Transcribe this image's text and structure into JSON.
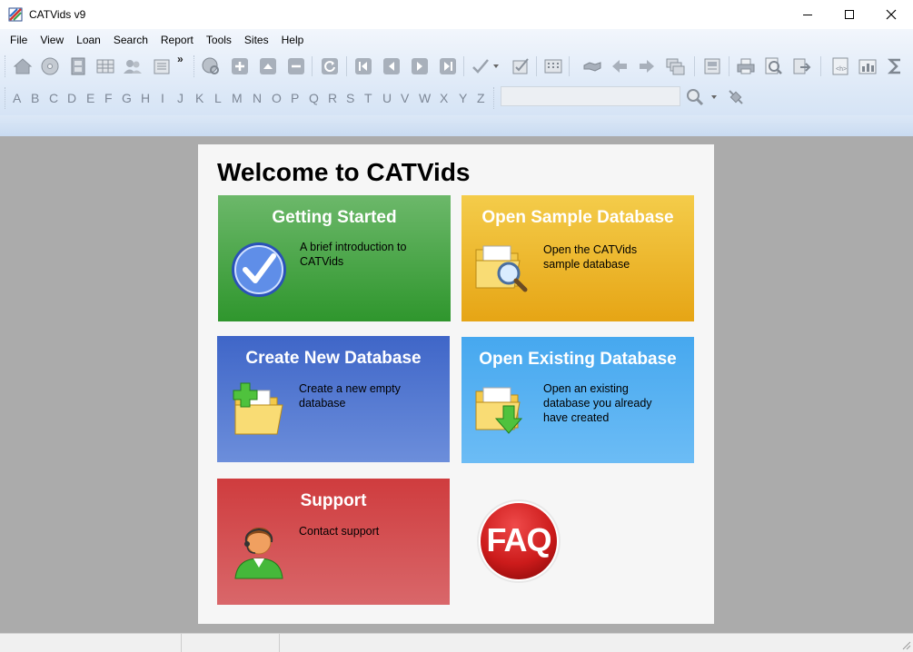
{
  "window": {
    "title": "CATVids v9"
  },
  "menu": [
    "File",
    "View",
    "Loan",
    "Search",
    "Report",
    "Tools",
    "Sites",
    "Help"
  ],
  "toolbar": {
    "overflow_glyph": "»"
  },
  "alphabet": [
    "A",
    "B",
    "C",
    "D",
    "E",
    "F",
    "G",
    "H",
    "I",
    "J",
    "K",
    "L",
    "M",
    "N",
    "O",
    "P",
    "Q",
    "R",
    "S",
    "T",
    "U",
    "V",
    "W",
    "X",
    "Y",
    "Z"
  ],
  "search": {
    "value": "",
    "placeholder": ""
  },
  "welcome": {
    "heading": "Welcome to CATVids",
    "tiles": [
      {
        "title": "Getting Started",
        "desc_line1": "A brief introduction to",
        "desc_line2": "CATVids",
        "color": "#3d9e3a"
      },
      {
        "title": "Open Sample Database",
        "desc_line1": "Open the CATVids",
        "desc_line2": "sample database",
        "color": "#ecb22a"
      },
      {
        "title": "Create New Database",
        "desc_line1": "Create a new empty",
        "desc_line2": "database",
        "color": "#4a73c8"
      },
      {
        "title": "Open Existing Database",
        "desc_line1": "Open an existing",
        "desc_line2": "database you already",
        "desc_line3": "have created",
        "color": "#4aaaf0"
      },
      {
        "title": "Support",
        "desc_line1": "Contact support",
        "color": "#d24a4a"
      }
    ],
    "faq_label": "FAQ"
  }
}
